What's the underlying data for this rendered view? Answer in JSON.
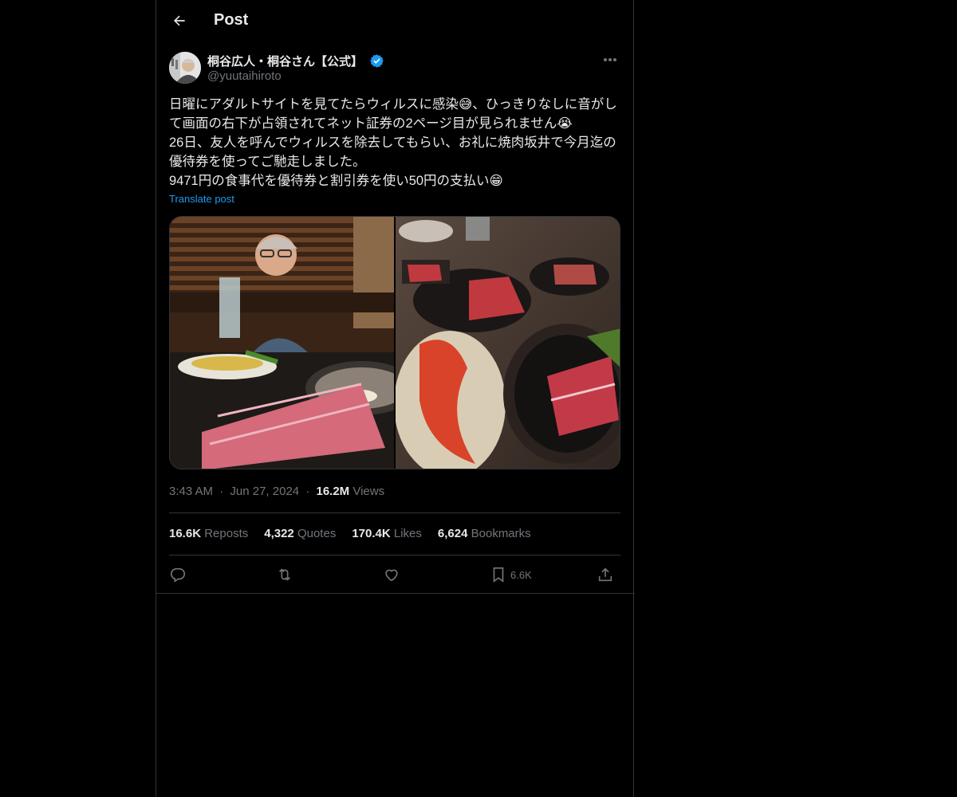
{
  "header": {
    "title": "Post",
    "back_icon": "arrow-left-icon"
  },
  "author": {
    "display_name": "桐谷広人・桐谷さん【公式】",
    "handle": "@yuutaihiroto",
    "verified_color": "#1d9bf0"
  },
  "post": {
    "text": "日曜にアダルトサイトを見てたらウィルスに感染😅、ひっきりなしに音がして画面の右下が占領されてネット証券の2ページ目が見られません😭\n26日、友人を呼んでウィルスを除去してもらい、お礼に焼肉坂井で今月迄の優待券を使ってご馳走しました。\n9471円の食事代を優待券と割引券を使い50円の支払い😁",
    "translate_label": "Translate post"
  },
  "meta": {
    "time": "3:43 AM",
    "dot1": "·",
    "date": "Jun 27, 2024",
    "dot2": "·",
    "views_count": "16.2M",
    "views_label": "Views"
  },
  "stats": {
    "reposts_count": "16.6K",
    "reposts_label": "Reposts",
    "quotes_count": "4,322",
    "quotes_label": "Quotes",
    "likes_count": "170.4K",
    "likes_label": "Likes",
    "bookmarks_count": "6,624",
    "bookmarks_label": "Bookmarks"
  },
  "actions": {
    "reply_icon": "reply-icon",
    "repost_icon": "repost-icon",
    "like_icon": "heart-icon",
    "bookmark_icon": "bookmark-icon",
    "bookmark_count": "6.6K",
    "share_icon": "share-icon"
  },
  "colors": {
    "background": "#000000",
    "text": "#e7e9ea",
    "muted": "#71767b",
    "accent": "#1d9bf0",
    "border": "#2f3336"
  }
}
